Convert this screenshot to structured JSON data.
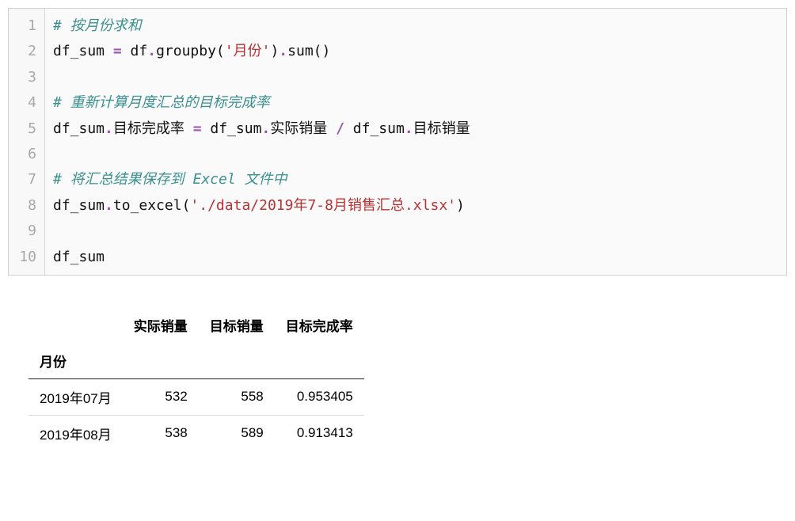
{
  "code": {
    "line_numbers": [
      "1",
      "2",
      "3",
      "4",
      "5",
      "6",
      "7",
      "8",
      "9",
      "10"
    ],
    "l1_comment": "# 按月份求和",
    "l2_a": "df_sum ",
    "l2_eq": "=",
    "l2_b": " df",
    "l2_dot1": ".",
    "l2_c": "groupby(",
    "l2_str": "'月份'",
    "l2_d": ")",
    "l2_dot2": ".",
    "l2_e": "sum()",
    "l4_comment": "# 重新计算月度汇总的目标完成率",
    "l5_a": "df_sum",
    "l5_dot1": ".",
    "l5_b": "目标完成率 ",
    "l5_eq": "=",
    "l5_c": " df_sum",
    "l5_dot2": ".",
    "l5_d": "实际销量 ",
    "l5_div": "/",
    "l5_e": " df_sum",
    "l5_dot3": ".",
    "l5_f": "目标销量",
    "l7_comment": "# 将汇总结果保存到 Excel 文件中",
    "l8_a": "df_sum",
    "l8_dot1": ".",
    "l8_b": "to_excel(",
    "l8_str": "'./data/2019年7-8月销售汇总.xlsx'",
    "l8_c": ")",
    "l10": "df_sum"
  },
  "output": {
    "columns": [
      "实际销量",
      "目标销量",
      "目标完成率"
    ],
    "index_name": "月份",
    "rows": [
      {
        "idx": "2019年07月",
        "c0": "532",
        "c1": "558",
        "c2": "0.953405"
      },
      {
        "idx": "2019年08月",
        "c0": "538",
        "c1": "589",
        "c2": "0.913413"
      }
    ]
  },
  "chart_data": {
    "type": "table",
    "title": "",
    "index_name": "月份",
    "columns": [
      "实际销量",
      "目标销量",
      "目标完成率"
    ],
    "index": [
      "2019年07月",
      "2019年08月"
    ],
    "data": [
      [
        532,
        558,
        0.953405
      ],
      [
        538,
        589,
        0.913413
      ]
    ]
  }
}
